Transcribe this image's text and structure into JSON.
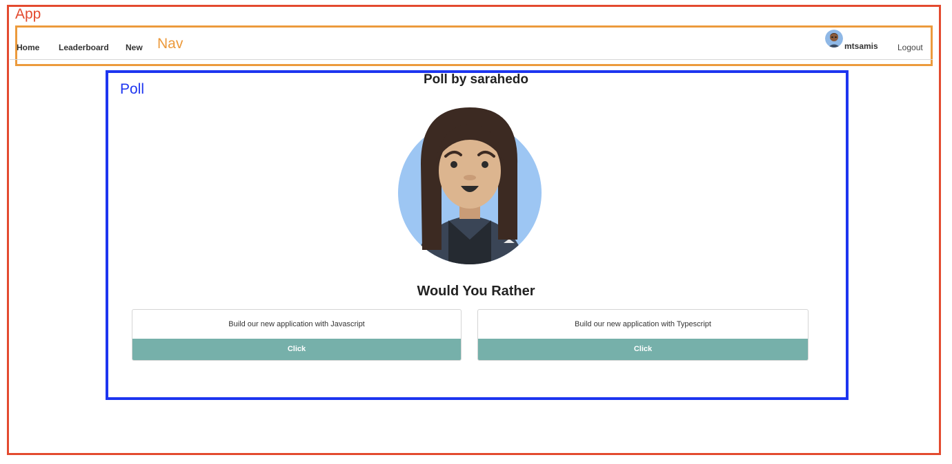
{
  "labels": {
    "app": "App",
    "nav": "Nav",
    "poll": "Poll"
  },
  "nav": {
    "home": "Home",
    "leaderboard": "Leaderboard",
    "new": "New",
    "user_name": "mtsamis",
    "logout": "Logout"
  },
  "poll": {
    "title": "Poll by sarahedo",
    "author_avatar_icon": "woman-avatar-icon",
    "heading": "Would You Rather",
    "options": [
      {
        "text": "Build our new application with Javascript",
        "button": "Click"
      },
      {
        "text": "Build our new application with Typescript",
        "button": "Click"
      }
    ]
  },
  "colors": {
    "app_outline": "#e34a2f",
    "nav_outline": "#ec9a3c",
    "poll_outline": "#1d35f0",
    "button_bg": "#76b0aa",
    "avatar_bg": "#9dc6f3"
  }
}
